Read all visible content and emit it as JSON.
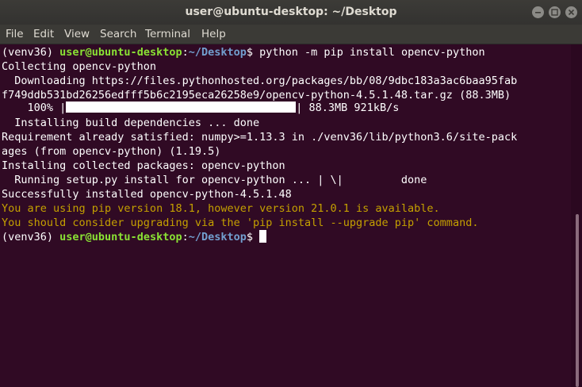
{
  "window": {
    "title": "user@ubuntu-desktop: ~/Desktop"
  },
  "menu": [
    "File",
    "Edit",
    "View",
    "Search",
    "Terminal",
    "Help"
  ],
  "colors": {
    "background": "#300a24",
    "prompt_user": "#8ae234",
    "prompt_path": "#729fcf",
    "warning": "#c4a000"
  },
  "terminal": {
    "prompt1": {
      "env": "(venv36) ",
      "user": "user@ubuntu-desktop",
      "sep": ":",
      "path": "~/Desktop",
      "dollar": "$ ",
      "command": "python -m pip install opencv-python"
    },
    "line2": "Collecting opencv-python",
    "line3": "  Downloading https://files.pythonhosted.org/packages/bb/08/9dbc183a3ac6baa95fab",
    "line4": "f749ddb531bd26256edfff5b6c2195eca26258e9/opencv-python-4.5.1.48.tar.gz (88.3MB)",
    "progress": {
      "percent_label": "    100% |",
      "fraction": 1.0,
      "end": "| 88.3MB 921kB/s"
    },
    "line6": "  Installing build dependencies ... done",
    "line7": "Requirement already satisfied: numpy>=1.13.3 in ./venv36/lib/python3.6/site-pack",
    "line8": "ages (from opencv-python) (1.19.5)",
    "line9": "Installing collected packages: opencv-python",
    "line10": "  Running setup.py install for opencv-python ... | \\|         done",
    "line11": "Successfully installed opencv-python-4.5.1.48",
    "line12": "You are using pip version 18.1, however version 21.0.1 is available.",
    "line13": "You should consider upgrading via the 'pip install --upgrade pip' command.",
    "prompt2": {
      "env": "(venv36) ",
      "user": "user@ubuntu-desktop",
      "sep": ":",
      "path": "~/Desktop",
      "dollar": "$ "
    }
  }
}
